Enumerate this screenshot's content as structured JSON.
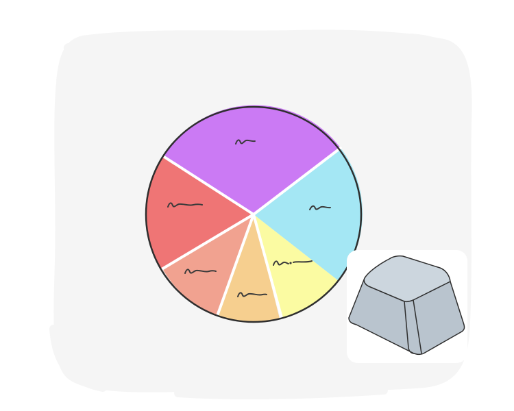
{
  "illustration": {
    "background_color": "#f5f5f5",
    "slices": [
      {
        "name": "purple",
        "color": "#cb7af4"
      },
      {
        "name": "cyan",
        "color": "#a4e7f4"
      },
      {
        "name": "yellow",
        "color": "#fbfba2"
      },
      {
        "name": "orange",
        "color": "#f6cf8f"
      },
      {
        "name": "salmon",
        "color": "#f1a290"
      },
      {
        "name": "red",
        "color": "#ef7575"
      }
    ],
    "outline_color": "#2e2e2e",
    "key": {
      "top_color": "#ccd6de",
      "side_color": "#b9c4ce"
    }
  }
}
